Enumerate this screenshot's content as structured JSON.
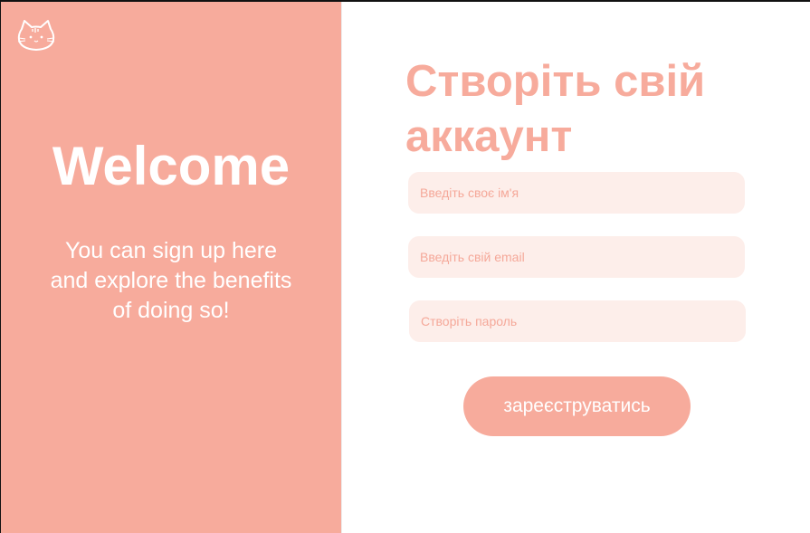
{
  "brand": {
    "logo_icon": "cat-face-icon"
  },
  "welcome": {
    "title": "Welcome",
    "text": "You can sign up here and explore the benefits of doing so!"
  },
  "form": {
    "title": "Створіть свій аккаунт",
    "fields": [
      {
        "placeholder": "Введіть своє ім'я",
        "value": ""
      },
      {
        "placeholder": "Введіть свій email",
        "value": ""
      },
      {
        "placeholder": "Створіть пароль",
        "value": ""
      }
    ],
    "submit_label": "зареєструватись"
  },
  "colors": {
    "accent": "#f7ab9c",
    "field_background": "#fdeeea",
    "text_on_accent": "#ffffff"
  }
}
